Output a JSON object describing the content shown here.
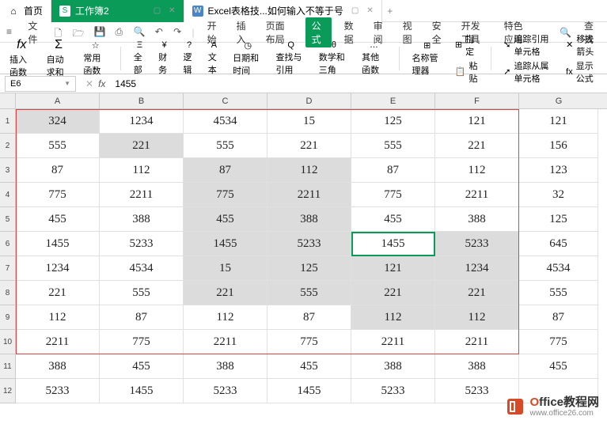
{
  "titlebar": {
    "home": "首页",
    "workbook": "工作簿2",
    "doc_tab": "Excel表格技...如何输入不等于号",
    "new_tab": "+"
  },
  "menubar": {
    "file": "文件",
    "items": [
      "开始",
      "插入",
      "页面布局",
      "公式",
      "数据",
      "审阅",
      "视图",
      "安全",
      "开发工具",
      "特色应用"
    ],
    "search": "查找"
  },
  "toolbar": {
    "insert_fn": "插入函数",
    "fx": "fx",
    "autosum": "自动求和",
    "sigma": "Σ",
    "common_fn": "常用函数",
    "star": "☆",
    "all": "全部",
    "all_ico": "Ξ",
    "finance": "财务",
    "fin_ico": "¥",
    "logic": "逻辑",
    "log_ico": "?",
    "text": "文本",
    "txt_ico": "A",
    "datetime": "日期和时间",
    "dt_ico": "◷",
    "lookup": "查找与引用",
    "lk_ico": "Q",
    "math": "数学和三角",
    "mt_ico": "θ",
    "other": "其他函数",
    "ot_ico": "…",
    "name_mgr": "名称管理器",
    "nm_ico": "⊞",
    "define": "指定",
    "paste": "粘贴",
    "trace_ref": "追踪引用单元格",
    "trace_dep": "追踪从属单元格",
    "remove_arrow": "移去箭头",
    "show_formula": "显示公式"
  },
  "formula_bar": {
    "name_box": "E6",
    "value": "1455"
  },
  "columns": [
    "A",
    "B",
    "C",
    "D",
    "E",
    "F",
    "G"
  ],
  "rows": [
    {
      "n": "1",
      "c": [
        "324",
        "1234",
        "4534",
        "15",
        "125",
        "121",
        "121"
      ],
      "hi": [
        0
      ]
    },
    {
      "n": "2",
      "c": [
        "555",
        "221",
        "555",
        "221",
        "555",
        "221",
        "156"
      ],
      "hi": [
        1
      ]
    },
    {
      "n": "3",
      "c": [
        "87",
        "112",
        "87",
        "112",
        "87",
        "112",
        "123"
      ],
      "hi": [
        2,
        3
      ]
    },
    {
      "n": "4",
      "c": [
        "775",
        "2211",
        "775",
        "2211",
        "775",
        "2211",
        "32"
      ],
      "hi": [
        2,
        3
      ]
    },
    {
      "n": "5",
      "c": [
        "455",
        "388",
        "455",
        "388",
        "455",
        "388",
        "125"
      ],
      "hi": [
        2,
        3
      ]
    },
    {
      "n": "6",
      "c": [
        "1455",
        "5233",
        "1455",
        "5233",
        "1455",
        "5233",
        "645"
      ],
      "hi": [
        2,
        3,
        5
      ],
      "active": 4
    },
    {
      "n": "7",
      "c": [
        "1234",
        "4534",
        "15",
        "125",
        "121",
        "1234",
        "4534"
      ],
      "hi": [
        2,
        3,
        4,
        5
      ]
    },
    {
      "n": "8",
      "c": [
        "221",
        "555",
        "221",
        "555",
        "221",
        "221",
        "555"
      ],
      "hi": [
        2,
        3,
        4,
        5
      ]
    },
    {
      "n": "9",
      "c": [
        "112",
        "87",
        "112",
        "87",
        "112",
        "112",
        "87"
      ],
      "hi": [
        4,
        5
      ]
    },
    {
      "n": "10",
      "c": [
        "2211",
        "775",
        "2211",
        "775",
        "2211",
        "2211",
        "775"
      ],
      "hi": []
    },
    {
      "n": "11",
      "c": [
        "388",
        "455",
        "388",
        "455",
        "388",
        "388",
        "455"
      ],
      "hi": []
    },
    {
      "n": "12",
      "c": [
        "5233",
        "1455",
        "5233",
        "1455",
        "5233",
        "5233",
        ""
      ],
      "hi": []
    }
  ],
  "watermark": {
    "title_o": "O",
    "title_rest": "ffice教程网",
    "url": "www.office26.com"
  }
}
